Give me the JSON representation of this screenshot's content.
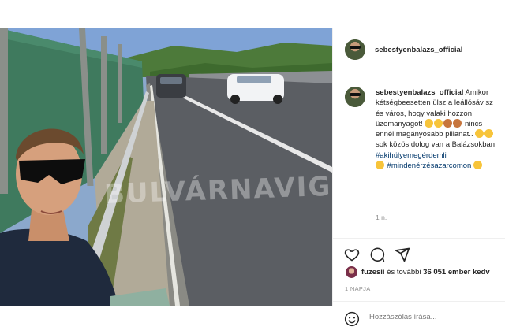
{
  "post": {
    "username": "sebestyenbalazs_official",
    "watermark": "BULVÁRNAVIGÁTOR",
    "caption": {
      "username": "sebestyenbalazs_official",
      "line1_text": "Amikor",
      "line2": "kétségbeesetten ülsz a leállósáv sz",
      "line3": "és város, hogy valaki hozzon",
      "line4": "üzemanyagot!",
      "line5_text": "nincs",
      "line6": "ennél magányosabb pillanat..",
      "line7": "sok közös dolog van a Balázsokban",
      "hashtag1": "#akihülyemegérdemli",
      "hashtag2": "#mindenérzésazarcomon"
    },
    "time_ago": "1 n.",
    "likes": {
      "user": "fuzesii",
      "connector": "és további",
      "count": "36 051",
      "suffix": "ember kedv"
    },
    "date_label": "1 NAPJA",
    "comment_placeholder": "Hozzászólás írása..."
  },
  "icons": {
    "like": "heart-icon",
    "comment": "comment-icon",
    "share": "send-icon",
    "emoji": "smile-icon"
  },
  "colors": {
    "text": "#262626",
    "muted": "#8e8e8e",
    "hashtag": "#00376b",
    "divider": "#efefef"
  }
}
